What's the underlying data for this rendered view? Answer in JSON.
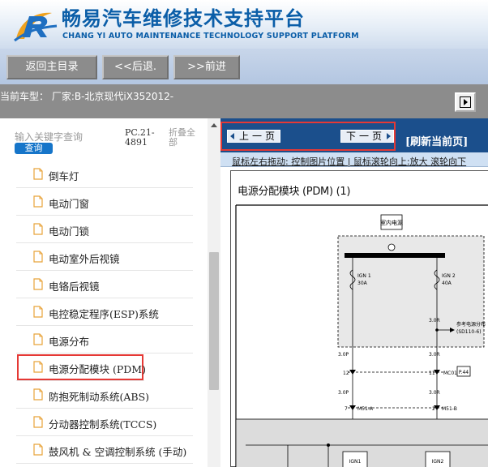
{
  "header": {
    "title": "畅易汽车维修技术支持平台",
    "subtitle": "CHANG YI AUTO MAINTENANCE TECHNOLOGY SUPPORT PLATFORM"
  },
  "toolbar": {
    "home_label": "返回主目录",
    "back_label": "<<后退.",
    "forward_label": ">>前进"
  },
  "status": {
    "current_car": "当前车型： 厂家:B-北京现代iX352012-"
  },
  "sidebar": {
    "search_label": "输入关键字查询",
    "search_button": "查询",
    "pc_code": "PC.21-4891",
    "collapse_all": "折叠全部",
    "items": [
      {
        "label": "倒车灯"
      },
      {
        "label": "电动门窗"
      },
      {
        "label": "电动门锁"
      },
      {
        "label": "电动室外后视镜"
      },
      {
        "label": "电铬后视镜"
      },
      {
        "label": "电控稳定程序(ESP)系统"
      },
      {
        "label": "电源分布"
      },
      {
        "label": "电源分配模块 (PDM)"
      },
      {
        "label": "防抱死制动系统(ABS)"
      },
      {
        "label": "分动器控制系统(TCCS)"
      },
      {
        "label": "鼓风机 & 空调控制系统 (手动)"
      }
    ],
    "selected_index": 7
  },
  "viewer": {
    "prev_label": "上一页",
    "next_label": "下一页",
    "refresh_label": "[刷新当前页]",
    "hint": "鼠标左右拖动: 控制图片位置 | 鼠标滚轮向上:放大   滚轮向下",
    "diagram": {
      "title": "电源分配模块 (PDM) (1)",
      "labels": {
        "box": "室内电源",
        "ign1": "IGN 1",
        "ign1_amp": "30A",
        "ign2": "IGN 2",
        "ign2_amp": "40A",
        "wire_left_top": "3.0P",
        "wire_left_mid": "3.0P",
        "wire_right_top": "3.0R",
        "wire_right_mid": "3.0R",
        "wire_right_mid2": "3.0R",
        "pin_left": "12",
        "pin_right": "11",
        "conn_mc": "MC01",
        "page_ref": "P.44",
        "ref_text": "参考电源分布",
        "ref_code": "(SD110-6)",
        "pin_left2": "7",
        "pin_right2": "2",
        "conn_left": "M51-A",
        "conn_right": "M51-B",
        "bottom_left": "IGN1",
        "bottom_right": "IGN2"
      }
    }
  },
  "colors": {
    "brand_blue": "#0b5ea8",
    "nav_blue": "#1b4f8c",
    "highlight_red": "#e53935",
    "toolbar_gray": "#8c8c8c"
  }
}
